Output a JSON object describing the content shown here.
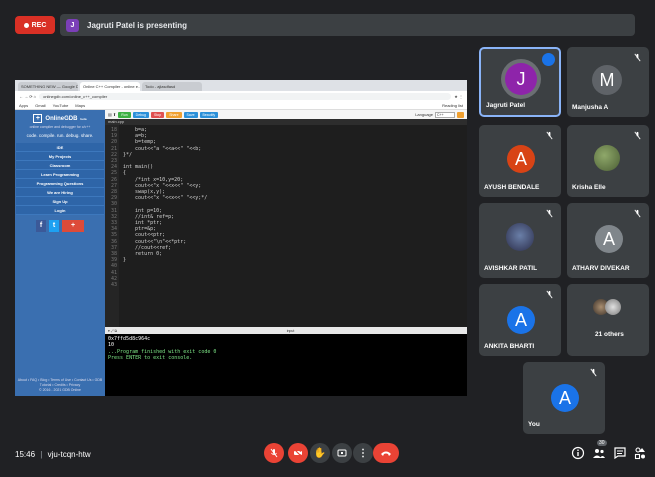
{
  "top": {
    "rec_label": "REC",
    "presenter_initial": "J",
    "presenting_text": "Jagruti Patel is presenting"
  },
  "shared_screen": {
    "browser_tabs": [
      "SOMETHING NEW — Google D...",
      "Online C++ Compiler - online e...",
      "Todo - ajlasdfasd"
    ],
    "url": "onlinegdb.com/online_c++_compiler",
    "bookmarks": [
      "Apps",
      "Gmail",
      "YouTube",
      "Maps",
      "Reading list"
    ],
    "gdb": {
      "logo": "OnlineGDB",
      "beta": "beta",
      "subtitle": "online compiler and debugger for c/c++",
      "tagline": "code. compile. run. debug. share.",
      "nav": [
        "IDE",
        "My Projects",
        "Classroom",
        "Learn Programming",
        "Programming Questions",
        "We are Hiring",
        "Sign Up",
        "Login"
      ],
      "social": [
        "f",
        "t",
        "+"
      ],
      "footer": [
        "About • FAQ • Blog • Terms of Use • Contact Us • GDB",
        "Tutorial • Credits • Privacy",
        "© 2016 - 2021 GDB Online"
      ]
    },
    "ide": {
      "buttons": [
        {
          "label": "Run",
          "color": "#3cb043"
        },
        {
          "label": "Debug",
          "color": "#2b90d9"
        },
        {
          "label": "Stop",
          "color": "#e05050"
        },
        {
          "label": "Share",
          "color": "#f0a030"
        },
        {
          "label": "Save",
          "color": "#2b90d9"
        },
        {
          "label": "Beautify",
          "color": "#2b90d9"
        }
      ],
      "language_label": "Language",
      "language_value": "C++",
      "file_tab": "main.cpp",
      "line_numbers": "18\n19\n20\n21\n22\n23\n24\n25\n26\n27\n28\n29\n30\n31\n32\n33\n34\n35\n36\n37\n38\n39\n40\n41\n42\n43",
      "code": "    b=a;\n    a=b;\n    b=temp;\n    cout<<\"a \"<<a<<\" \"<<b;\n}*/\n\nint main()\n{\n    /*int x=10,y=20;\n    cout<<\"x \"<<x<<\" \"<<y;\n    swap(x,y);\n    cout<<\"x \"<<x<<\" \"<<y;*/\n\n    int p=10;\n    //int& ref=p;\n    int *ptr;\n    ptr=&p;\n    cout<<ptr;\n    cout<<\"\\n\"<<*ptr;\n    //cout<<ref;\n    return 0;\n}\n\n",
      "io_label": "input",
      "console_lines": [
        "0x7ffd5d8c964c",
        "10",
        "",
        "",
        "...Program finished with exit code 0",
        "Press ENTER to exit console."
      ]
    }
  },
  "participants": [
    {
      "name": "Jagruti Patel",
      "initial": "J",
      "color": "#8e24aa",
      "speaking": true
    },
    {
      "name": "Manjusha A",
      "initial": "M",
      "color": "#5f6368",
      "muted": true
    },
    {
      "name": "AYUSH BENDALE",
      "initial": "A",
      "color": "#d84315",
      "muted": true
    },
    {
      "name": "Krisha Elle",
      "photo": true,
      "muted": true
    },
    {
      "name": "AVISHKAR PATIL",
      "photo": true,
      "muted": true
    },
    {
      "name": "ATHARV DIVEKAR",
      "initial": "A",
      "color": "#80868b",
      "muted": true
    },
    {
      "name": "ANKITA BHARTI",
      "initial": "A",
      "color": "#1a73e8",
      "muted": true
    },
    {
      "name": "21 others",
      "photo": true
    },
    {
      "name": "You",
      "initial": "A",
      "color": "#1a73e8",
      "muted": true
    }
  ],
  "bottom": {
    "time": "15:46",
    "separator": "|",
    "meeting_code": "vju-tcqn-htw",
    "controls": [
      "mic-off",
      "camera-off",
      "raise-hand",
      "present",
      "more",
      "end-call"
    ],
    "right_icons": [
      "info",
      "people",
      "chat",
      "activities"
    ],
    "people_count": "30"
  },
  "colors": {
    "accent": "#8ab4f8",
    "danger": "#ea4335",
    "tile": "#3c4043",
    "bg": "#202124"
  }
}
